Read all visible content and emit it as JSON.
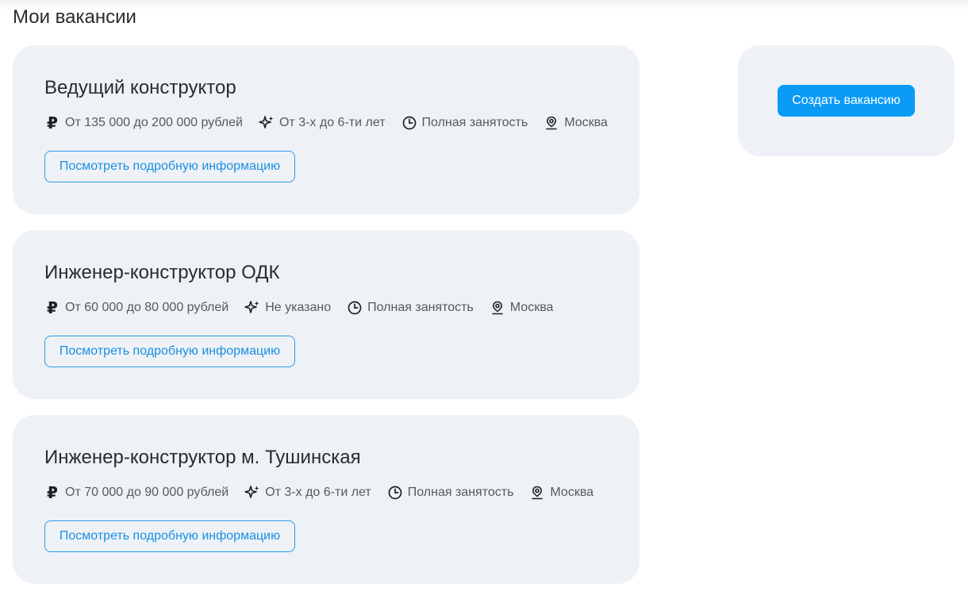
{
  "page": {
    "title": "Мои вакансии"
  },
  "vacancies": [
    {
      "title": "Ведущий конструктор",
      "salary": "От 135 000 до 200 000 рублей",
      "experience": "От 3-х до 6-ти лет",
      "employment": "Полная занятость",
      "location": "Москва",
      "details_label": "Посмотреть подробную информацию"
    },
    {
      "title": "Инженер-конструктор ОДК",
      "salary": "От 60 000 до 80 000 рублей",
      "experience": "Не указано",
      "employment": "Полная занятость",
      "location": "Москва",
      "details_label": "Посмотреть подробную информацию"
    },
    {
      "title": "Инженер-конструктор м. Тушинская",
      "salary": "От 70 000 до 90 000 рублей",
      "experience": "От 3-х до 6-ти лет",
      "employment": "Полная занятость",
      "location": "Москва",
      "details_label": "Посмотреть подробную информацию"
    }
  ],
  "sidebar": {
    "create_label": "Создать вакансию"
  },
  "icons": {
    "salary": "ruble-icon",
    "experience": "sparkle-icon",
    "employment": "clock-icon",
    "location": "location-pin-icon"
  },
  "colors": {
    "accent": "#0a9bf7",
    "link": "#1a8fe3",
    "card_bg": "#eef2f6",
    "text": "#2b2b2b",
    "muted": "#555a60"
  }
}
